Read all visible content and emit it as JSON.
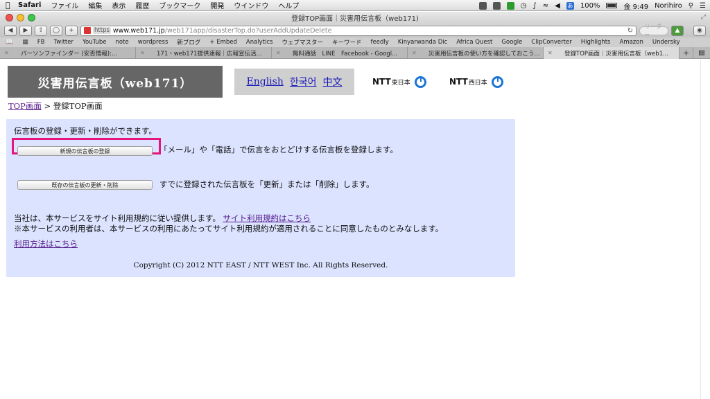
{
  "menubar": {
    "app": "Safari",
    "items": [
      "ファイル",
      "編集",
      "表示",
      "履歴",
      "ブックマーク",
      "開発",
      "ウインドウ",
      "ヘルプ"
    ],
    "battery": "100%",
    "lang_badge": "あ",
    "clock": "金 9:49",
    "user": "Norihiro"
  },
  "window": {
    "title": "登録TOP画面｜災害用伝言板（web171)"
  },
  "toolbar": {
    "url_scheme": "https",
    "url_host": "www.web171.jp",
    "url_path": "/web171app/disasterTop.do?userAddUpdateDelete",
    "reader": "リーダー"
  },
  "bookmarks": [
    "FB",
    "Twitter",
    "YouTube",
    "note",
    "wordpress",
    "新ブログ",
    "+ Embed",
    "Analytics",
    "ウェブマスター",
    "キーワード",
    "feedly",
    "Kinyarwanda Dic",
    "Africa Quest",
    "Google",
    "ClipConverter",
    "Highlights",
    "Amazon",
    "Undersky"
  ],
  "tabs": [
    {
      "title": "パーソンファインダー (安否情報):..."
    },
    {
      "title": "171・web171提供速報｜広報宣伝活..."
    },
    {
      "title": "無料通話　LINE　Facebook - Googl..."
    },
    {
      "title": "災害用伝言板の使い方を確認しておこう..."
    },
    {
      "title": "登録TOP画面｜災害用伝言板（web1..."
    }
  ],
  "page": {
    "logo": "災害用伝言板（web171）",
    "languages": [
      "English",
      "한국어",
      "中文"
    ],
    "ntt_east": {
      "brand": "NTT",
      "region": "東日本"
    },
    "ntt_west": {
      "brand": "NTT",
      "region": "西日本"
    },
    "breadcrumb_link": "TOP画面",
    "breadcrumb_sep": " > ",
    "breadcrumb_current": "登録TOP画面",
    "intro": "伝言板の登録・更新・削除ができます。",
    "new_button": "新規の伝言板の登録",
    "new_desc": "「メール」や「電話」で伝言をおとどけする伝言板を登録します。",
    "edit_button": "既存の伝言板の更新・削除",
    "edit_desc": "すでに登録された伝言板を「更新」または「削除」します。",
    "terms_text": "当社は、本サービスをサイト利用規約に従い提供します。",
    "terms_link": "サイト利用規約はこちら",
    "terms_note": "※本サービスの利用者は、本サービスの利用にあたってサイト利用規約が適用されることに同意したものとみなします。",
    "howto_link": "利用方法はこちら",
    "copyright": "Copyright (C) 2012 NTT EAST / NTT WEST Inc. All Rights Reserved."
  },
  "colors": {
    "panel_bg": "#dbe3ff",
    "logo_bg": "#666666",
    "highlight": "#e6147e",
    "ntt_blue": "#1a74d8"
  }
}
